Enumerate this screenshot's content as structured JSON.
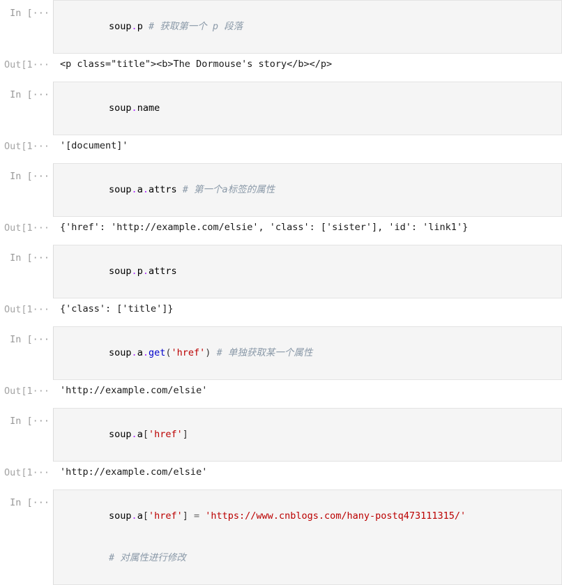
{
  "app": {
    "name": "jupyter-notebook",
    "background": "#ffffff",
    "input_cell_background": "#f5f5f5",
    "input_cell_border": "#e3e3e3"
  },
  "colors": {
    "prompt": "#999999",
    "code_default": "#000000",
    "operator": "#aa22ff",
    "function": "#0000cc",
    "string": "#bb0000",
    "comment": "#8a99a8",
    "output_text": "#1a1a1a"
  },
  "prompts": {
    "input": "In  [···",
    "output": "Out[1···"
  },
  "cells": [
    {
      "id": "cell-1",
      "type": "code",
      "prompt": "In  [···",
      "source_plain": "soup.p # 获取第一个 p 段落",
      "tokens": {
        "name1": "soup",
        "dot1": ".",
        "name2": "p",
        "space": " ",
        "comment": "# 获取第一个 p 段落"
      },
      "output": {
        "prompt": "Out[1···",
        "text": "<p class=\"title\"><b>The Dormouse's story</b></p>"
      }
    },
    {
      "id": "cell-2",
      "type": "code",
      "prompt": "In  [···",
      "source_plain": "soup.name",
      "tokens": {
        "name1": "soup",
        "dot1": ".",
        "name2": "name"
      },
      "output": {
        "prompt": "Out[1···",
        "text": "'[document]'"
      }
    },
    {
      "id": "cell-3",
      "type": "code",
      "prompt": "In  [···",
      "source_plain": "soup.a.attrs # 第一个a标签的属性",
      "tokens": {
        "name1": "soup",
        "dot1": ".",
        "name2": "a",
        "dot2": ".",
        "name3": "attrs",
        "comment": "# 第一个a标签的属性"
      },
      "output": {
        "prompt": "Out[1···",
        "text": "{'href': 'http://example.com/elsie', 'class': ['sister'], 'id': 'link1'}"
      }
    },
    {
      "id": "cell-4",
      "type": "code",
      "prompt": "In  [···",
      "source_plain": "soup.p.attrs",
      "tokens": {
        "name1": "soup",
        "dot1": ".",
        "name2": "p",
        "dot2": ".",
        "name3": "attrs"
      },
      "output": {
        "prompt": "Out[1···",
        "text": "{'class': ['title']}"
      }
    },
    {
      "id": "cell-5",
      "type": "code",
      "prompt": "In  [···",
      "source_plain": "soup.a.get('href') # 单独获取某一个属性",
      "tokens": {
        "name1": "soup",
        "dot1": ".",
        "name2": "a",
        "dot2": ".",
        "fn": "get",
        "paren_open": "(",
        "string": "'href'",
        "paren_close": ")",
        "comment": "# 单独获取某一个属性"
      },
      "output": {
        "prompt": "Out[1···",
        "text": "'http://example.com/elsie'"
      }
    },
    {
      "id": "cell-6",
      "type": "code",
      "prompt": "In  [···",
      "source_plain": "soup.a['href']",
      "tokens": {
        "name1": "soup",
        "dot1": ".",
        "name2": "a",
        "bracket_open": "[",
        "string": "'href'",
        "bracket_close": "]"
      },
      "output": {
        "prompt": "Out[1···",
        "text": "'http://example.com/elsie'"
      }
    },
    {
      "id": "cell-7",
      "type": "code",
      "prompt": "In  [···",
      "source_plain": "soup.a['href'] = 'https://www.cnblogs.com/hany-postq473111315/'\n# 对属性进行修改",
      "tokens": {
        "name1": "soup",
        "dot1": ".",
        "name2": "a",
        "bracket_open": "[",
        "string1": "'href'",
        "bracket_close": "]",
        "equals": " = ",
        "string2": "'https://www.cnblogs.com/hany-postq473111315/'",
        "comment": "# 对属性进行修改"
      },
      "output": null
    }
  ]
}
